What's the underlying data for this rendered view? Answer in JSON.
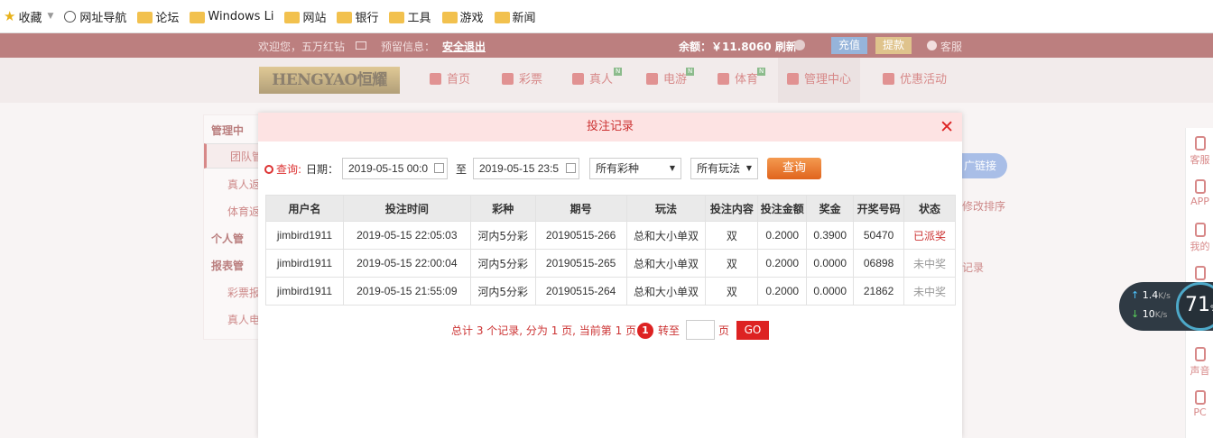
{
  "bookmarks": [
    {
      "label": "收藏",
      "icon": "star-icon"
    },
    {
      "label": "网址导航",
      "icon": "globe-icon"
    },
    {
      "label": "论坛",
      "icon": "folder-icon"
    },
    {
      "label": "Windows Li",
      "icon": "folder-icon"
    },
    {
      "label": "网站",
      "icon": "folder-icon"
    },
    {
      "label": "银行",
      "icon": "folder-icon"
    },
    {
      "label": "工具",
      "icon": "folder-icon"
    },
    {
      "label": "游戏",
      "icon": "folder-icon"
    },
    {
      "label": "新闻",
      "icon": "folder-icon"
    }
  ],
  "topbar": {
    "welcome": "欢迎您，五万红钻",
    "notice": "预留信息：",
    "logout": "安全退出",
    "balance": "余额：￥11.8060 刷新",
    "deposit": "充值",
    "withdraw": "提款",
    "service": "客服"
  },
  "nav": {
    "logo": "HENGYAO恒耀",
    "items": [
      {
        "label": "首页",
        "badge": ""
      },
      {
        "label": "彩票",
        "badge": ""
      },
      {
        "label": "真人",
        "badge": "N"
      },
      {
        "label": "电游",
        "badge": "N"
      },
      {
        "label": "体育",
        "badge": "N"
      },
      {
        "label": "管理中心",
        "badge": ""
      },
      {
        "label": "优惠活动",
        "badge": ""
      }
    ]
  },
  "sidebar": {
    "items": [
      "管理中",
      "团队管",
      "真人返",
      "体育返",
      "个人管",
      "报表管",
      "彩票报",
      "真人电"
    ]
  },
  "right_tools": [
    "客服",
    "APP",
    "我的",
    "",
    "",
    "声音",
    "PC"
  ],
  "bg_fragments": {
    "link_btn": "广链接",
    "sort": "修改排序",
    "record": "记录"
  },
  "speed": {
    "up": "1.4",
    "down": "10",
    "unit": "K/s",
    "percent": "71",
    "percent_sign": "%"
  },
  "modal": {
    "title": "投注记录",
    "close": "✕",
    "query_label": "查询:",
    "date_label": "日期：",
    "date_from": "2019-05-15 00:0",
    "to": "至",
    "date_to": "2019-05-15 23:5",
    "lottery_select": "所有彩种",
    "play_select": "所有玩法",
    "query_btn": "查询",
    "columns": [
      "用户名",
      "投注时间",
      "彩种",
      "期号",
      "玩法",
      "投注内容",
      "投注金额",
      "奖金",
      "开奖号码",
      "状态"
    ],
    "rows": [
      [
        "jimbird1911",
        "2019-05-15 22:05:03",
        "河内5分彩",
        "20190515-266",
        "总和大小单双",
        "双",
        "0.2000",
        "0.3900",
        "50470",
        "已派奖"
      ],
      [
        "jimbird1911",
        "2019-05-15 22:00:04",
        "河内5分彩",
        "20190515-265",
        "总和大小单双",
        "双",
        "0.2000",
        "0.0000",
        "06898",
        "未中奖"
      ],
      [
        "jimbird1911",
        "2019-05-15 21:55:09",
        "河内5分彩",
        "20190515-264",
        "总和大小单双",
        "双",
        "0.2000",
        "0.0000",
        "21862",
        "未中奖"
      ]
    ],
    "pager": {
      "summary": "总计 3 个记录, 分为 1 页, 当前第 1 页",
      "current": "1",
      "goto": "转至",
      "page": "页",
      "go": "GO"
    }
  }
}
